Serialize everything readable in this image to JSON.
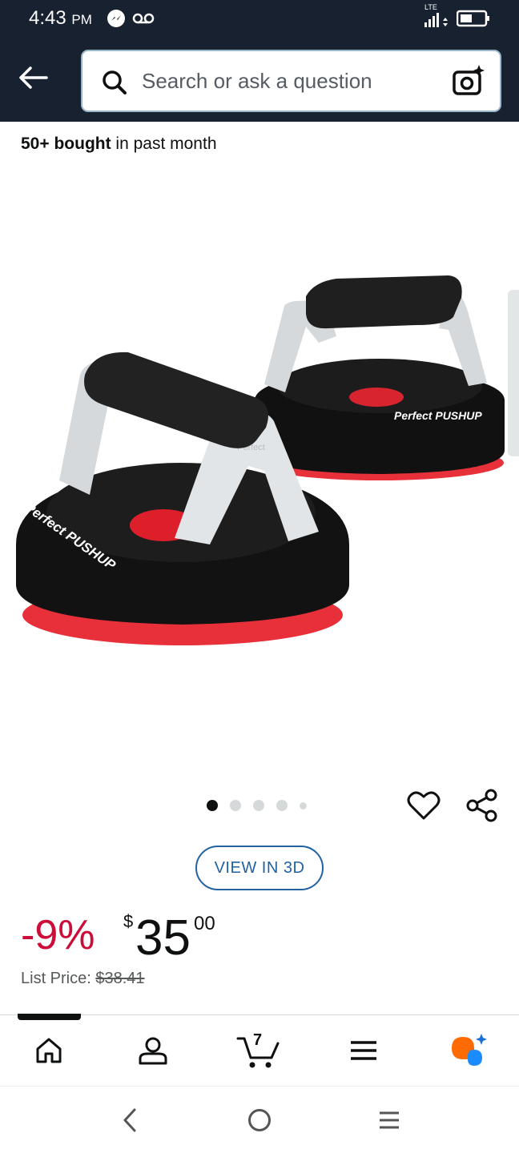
{
  "status_bar": {
    "time": "4:43",
    "ampm": "PM",
    "network": "LTE"
  },
  "header": {
    "search_placeholder": "Search or ask a question"
  },
  "product": {
    "bought_bold": "50+ bought",
    "bought_rest": " in past month",
    "image_brand_large": "Perfect PUSHUP",
    "image_brand_small": "Perfect PUSHUP",
    "image_handle_text": "Perfect",
    "image_count": 5,
    "active_image": 1,
    "view_3d_label": "VIEW IN 3D",
    "discount": "-9%",
    "currency": "$",
    "price_whole": "35",
    "price_fraction": "00",
    "list_price_label": "List Price: ",
    "list_price_value": "$38.41"
  },
  "tabbar": {
    "items": [
      {
        "name": "home",
        "icon": "home-icon"
      },
      {
        "name": "account",
        "icon": "person-icon"
      },
      {
        "name": "cart",
        "icon": "cart-icon",
        "count": "7"
      },
      {
        "name": "menu",
        "icon": "hamburger-icon"
      },
      {
        "name": "rufus",
        "icon": "rufus-ai-icon"
      }
    ],
    "active": "home"
  },
  "colors": {
    "header_bg": "#172130",
    "deal_red": "#cc0c39",
    "link_blue": "#2162a1",
    "rufus_orange": "#ff6b00",
    "rufus_blue": "#1a8cff"
  }
}
